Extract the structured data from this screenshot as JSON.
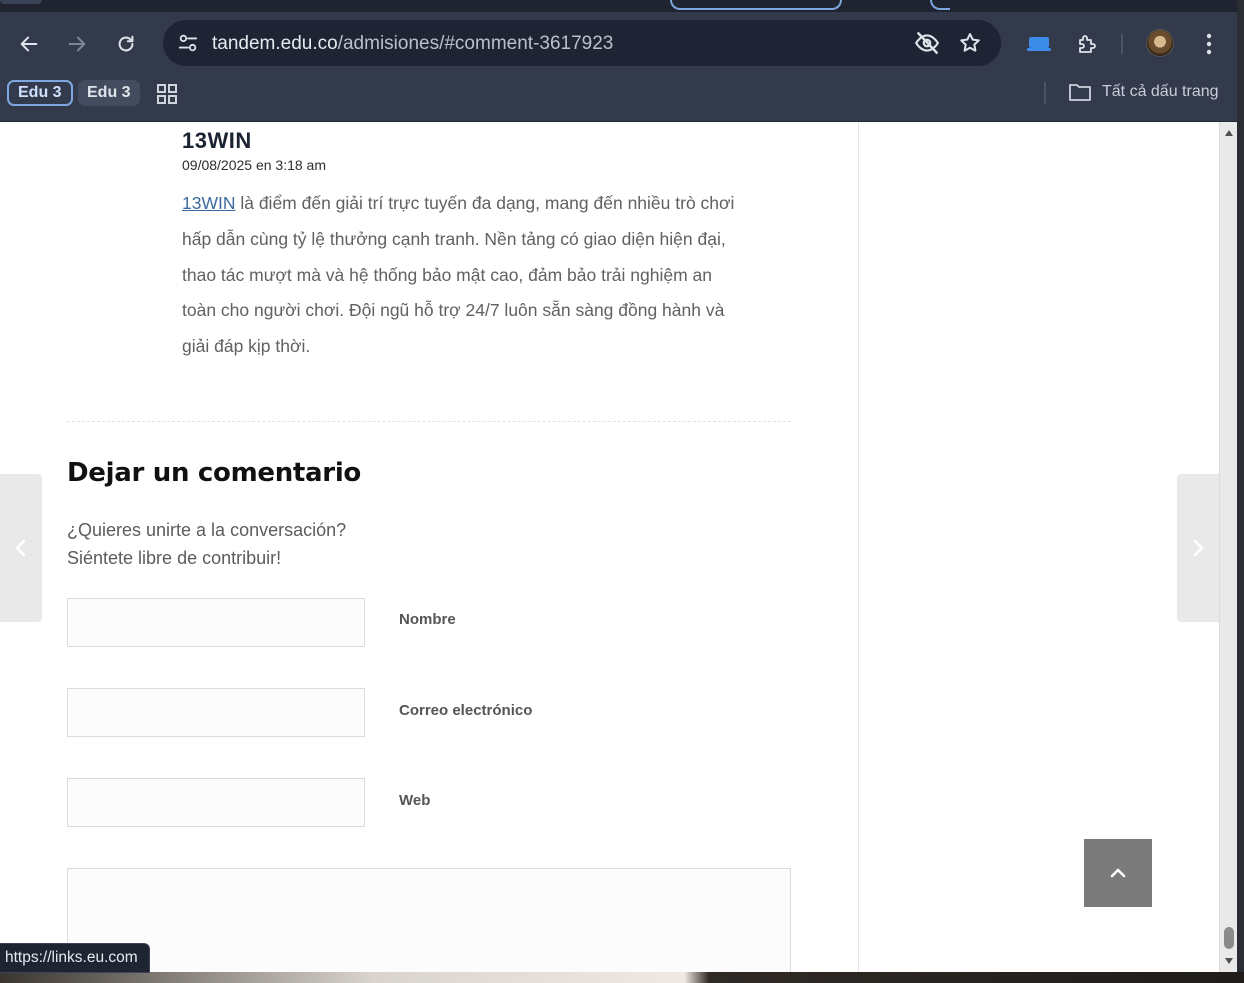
{
  "browser": {
    "address": {
      "url_host": "tandem.edu.co",
      "url_path": "/admisiones/#comment-3617923"
    },
    "bookmarks": [
      {
        "label": "Edu 3"
      },
      {
        "label": "Edu 3"
      }
    ],
    "all_bookmarks_label": "Tất cả dấu trang",
    "status_url": "https://links.eu.com"
  },
  "comment": {
    "author": "13WIN",
    "date": "09/08/2025 en 3:18 am",
    "link_text": "13WIN",
    "body": " là điểm đến giải trí trực tuyến đa dạng, mang đến nhiều trò chơi hấp dẫn cùng tỷ lệ thưởng cạnh tranh. Nền tảng có giao diện hiện đại, thao tác mượt mà và hệ thống bảo mật cao, đảm bảo trải nghiệm an toàn cho người chơi. Đội ngũ hỗ trợ 24/7 luôn sẵn sàng đồng hành và giải đáp kịp thời."
  },
  "form": {
    "title": "Dejar un comentario",
    "desc_line1": "¿Quieres unirte a la conversación?",
    "desc_line2": "Siéntete libre de contribuir!",
    "fields": [
      {
        "label": "Nombre",
        "value": ""
      },
      {
        "label": "Correo electrónico",
        "value": ""
      },
      {
        "label": "Web",
        "value": ""
      }
    ],
    "comment_value": ""
  },
  "icons": {
    "back": "back-arrow-icon",
    "forward": "forward-arrow-icon",
    "reload": "reload-icon",
    "site_settings": "tune-icon",
    "tracking": "eye-off-icon",
    "bookmark": "star-icon",
    "extensions": "puzzle-icon",
    "menu": "more-vertical-icon"
  },
  "colors": {
    "chrome_bg": "#323a4b",
    "omnibox_bg": "#1e2433",
    "accent": "#7ea6e0",
    "link": "#3b6b9e",
    "back_to_top": "#7a7a7a"
  }
}
